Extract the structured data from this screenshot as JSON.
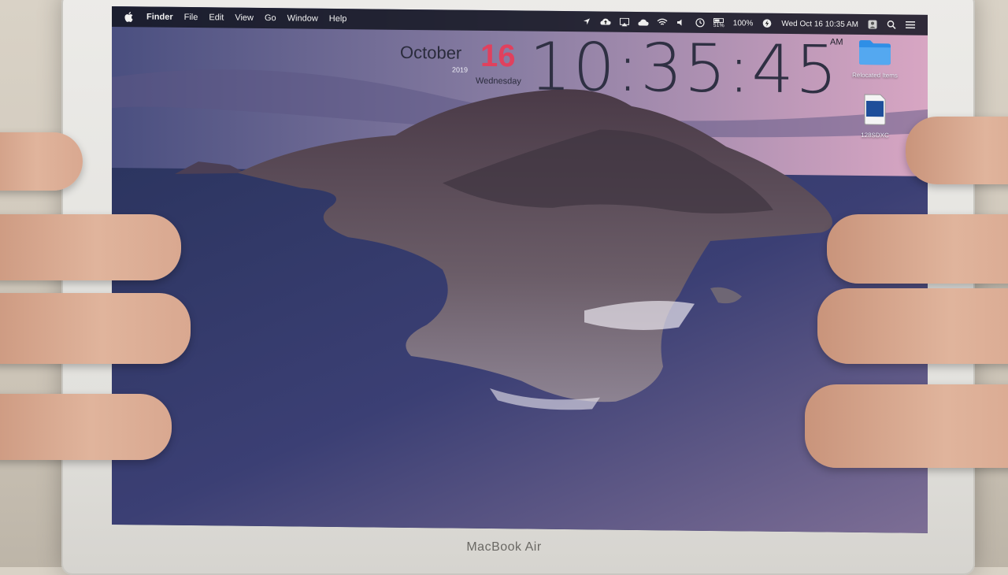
{
  "menubar": {
    "app_name": "Finder",
    "items": [
      "File",
      "Edit",
      "View",
      "Go",
      "Window",
      "Help"
    ],
    "status": {
      "battery_small": "51%",
      "battery_percent": "100%",
      "datetime": "Wed Oct 16  10:35 AM"
    }
  },
  "clock_widget": {
    "month": "October",
    "day": "16",
    "year": "2019",
    "weekday": "Wednesday",
    "time": "10:35:45",
    "ampm": "AM"
  },
  "desktop": {
    "icons": [
      {
        "label": "Relocated Items",
        "icon": "folder-icon"
      },
      {
        "label": "128SDXC",
        "icon": "sd-card-icon"
      }
    ]
  },
  "device": {
    "brand": "MacBook Air"
  },
  "colors": {
    "accent_day": "#e0415e",
    "menubar": "#14162e",
    "folder": "#2f8fe6"
  }
}
